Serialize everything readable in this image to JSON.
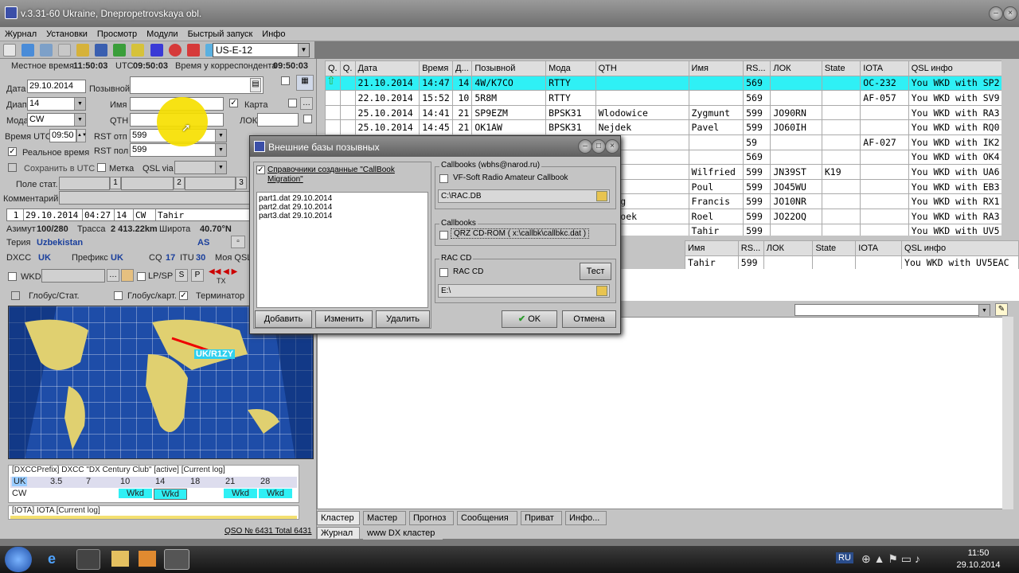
{
  "window": {
    "title": "v.3.31-60 Ukraine, Dnepropetrovskaya obl."
  },
  "menu": [
    "Журнал",
    "Установки",
    "Просмотр",
    "Модули",
    "Быстрый запуск",
    "Инфо"
  ],
  "toolbar": {
    "mode_select": "US-E-12"
  },
  "timebar": {
    "local_label": "Местное время",
    "local_value": "11:50:03",
    "utc_label": "UTC",
    "utc_value": "09:50:03",
    "corr_label": "Время у корреспондента",
    "corr_value": "09:50:03"
  },
  "form": {
    "date_label": "Дата",
    "date_value": "29.10.2014",
    "call_label": "Позывной",
    "band_label": "Диап",
    "band_value": "14",
    "name_label": "Имя",
    "map_label": "Карта",
    "mode_label": "Мода",
    "mode_value": "CW",
    "qth_label": "QTH",
    "loc_label": "ЛОК",
    "utc_time_label": "Время UTC",
    "utc_time_value": "09:50",
    "rst_sent_label": "RST отп",
    "rst_sent_value": "599",
    "real_time_label": "Реальное время",
    "rst_rcvd_label": "RST пол",
    "rst_rcvd_value": "599",
    "save_utc_label": "Сохранить в UTC",
    "mark_label": "Метка",
    "qsl_via_label": "QSL via",
    "field_stat_label": "Поле стат.",
    "stat_btns": [
      "1",
      "2",
      "3"
    ],
    "comment_label": "Комментарий"
  },
  "lastqso": {
    "num": "1",
    "date": "29.10.2014",
    "time": "04:27",
    "band": "14",
    "mode": "CW",
    "name": "Tahir"
  },
  "info": {
    "azimuth_label": "Азимут",
    "azimuth_value": "100/280",
    "route_label": "Трасса",
    "route_value": "2 413.22km",
    "lat_label": "Широта",
    "lat_value": "40.70°N",
    "territory_label": "Терия",
    "territory_value": "Uzbekistan",
    "continent": "AS",
    "dxcc_label": "DXCC",
    "dxcc_value": "UK",
    "prefix_label": "Префикс",
    "prefix_value": "UK",
    "cq_label": "CQ",
    "cq_value": "17",
    "itu_label": "ITU",
    "itu_value": "30",
    "myqsl_label": "Моя QSL",
    "wkd_label": "WKD",
    "lpsp_label": "LP/SP",
    "s_btn": "S",
    "p_btn": "P",
    "tx_label": "TX",
    "globe_stat_label": "Глобус/Стат.",
    "globe_map_label": "Глобус/карт.",
    "terminator_label": "Терминатор"
  },
  "map": {
    "callsign_tag": "UK/R1ZY"
  },
  "dxcc_panel": {
    "title": "[DXCCPrefix] DXCC \"DX Century Club\" [active] [Current log]",
    "headers": [
      "UK",
      "3.5",
      "7",
      "10",
      "14",
      "18",
      "21",
      "28"
    ],
    "row_label": "CW",
    "row_values": [
      "",
      "",
      "Wkd",
      "Wkd",
      "",
      "Wkd",
      "Wkd"
    ]
  },
  "iota_panel": {
    "title": "[IOTA] IOTA [Current log]"
  },
  "status": {
    "qso_count": "QSO № 6431 Total 6431"
  },
  "log_table": {
    "headers": [
      "Q.",
      "Q.",
      "Дата",
      "Время",
      "Д...",
      "Позывной",
      "Мода",
      "QTH",
      "Имя",
      "RS...",
      "ЛОК",
      "State",
      "IOTA",
      "QSL инфо"
    ],
    "rows": [
      [
        "",
        "",
        "21.10.2014",
        "14:47",
        "14",
        "4W/K7CO",
        "RTTY",
        "",
        "",
        "569",
        "",
        "",
        "OC-232",
        "You WKD with SP2"
      ],
      [
        "",
        "",
        "22.10.2014",
        "15:52",
        "10",
        "5R8M",
        "RTTY",
        "",
        "",
        "569",
        "",
        "",
        "AF-057",
        "You WKD with SV9"
      ],
      [
        "",
        "",
        "25.10.2014",
        "14:41",
        "21",
        "SP9EZM",
        "BPSK31",
        "Wlodowice",
        "Zygmunt",
        "599",
        "JO90RN",
        "",
        "",
        "You WKD with RA3"
      ],
      [
        "",
        "",
        "25.10.2014",
        "14:45",
        "21",
        "OK1AW",
        "BPSK31",
        "Nejdek",
        "Pavel",
        "599",
        "JO60IH",
        "",
        "",
        "You WKD with RQ0"
      ],
      [
        "",
        "",
        "",
        "",
        "",
        "",
        "",
        "",
        "",
        "59",
        "",
        "",
        "AF-027",
        "You WKD with IK2"
      ],
      [
        "",
        "",
        "",
        "",
        "",
        "",
        "",
        "",
        "",
        "569",
        "",
        "",
        "",
        "You WKD with OK4"
      ],
      [
        "",
        "",
        "",
        "",
        "",
        "",
        "",
        "heim",
        "Wilfried",
        "599",
        "JN39ST",
        "K19",
        "",
        "You WKD with UA6"
      ],
      [
        "",
        "",
        "",
        "",
        "",
        "",
        "",
        "ens",
        "Poul",
        "599",
        "JO45WU",
        "",
        "",
        "You WKD with EB3"
      ],
      [
        "",
        "",
        "",
        "",
        "",
        "",
        "",
        "coing",
        "Francis",
        "599",
        "JO10NR",
        "",
        "",
        "You WKD with RX1"
      ],
      [
        "",
        "",
        "",
        "",
        "",
        "",
        "",
        "cebroek",
        "Roel",
        "599",
        "JO22OQ",
        "",
        "",
        "You WKD with RA3"
      ],
      [
        "",
        "",
        "",
        "",
        "",
        "",
        "",
        "",
        "Tahir",
        "599",
        "",
        "",
        "",
        "You WKD with UV5"
      ]
    ]
  },
  "lower_table": {
    "headers": [
      "Имя",
      "RS...",
      "ЛОК",
      "State",
      "IOTA",
      "QSL инфо"
    ],
    "row": [
      "Tahir",
      "599",
      "",
      "",
      "",
      "You WKD with UV5EAC"
    ]
  },
  "tabs": [
    "Кластер",
    "Мастер",
    "Прогноз",
    "Сообщения",
    "Приват",
    "Инфо..."
  ],
  "tabs2": [
    "Журнал",
    "www DX кластер"
  ],
  "dialog": {
    "title": "Внешние базы позывных",
    "callbook_check": "Справочники созданные \"CallBook Migration\"",
    "files": [
      "part1.dat 29.10.2014",
      "part2.dat 29.10.2014",
      "part3.dat 29.10.2014"
    ],
    "add_btn": "Добавить",
    "edit_btn": "Изменить",
    "delete_btn": "Удалить",
    "grp1_title": "Callbooks (wbhs@narod.ru)",
    "vf_soft_label": "VF-Soft Radio Amateur Callbook",
    "vf_soft_path": "C:\\RAC.DB",
    "grp2_title": "Callbooks",
    "qrz_label": "QRZ CD-ROM  ( x:\\callbk\\callbkc.dat )",
    "grp3_title": "RAC CD",
    "rac_cd_label": "RAC CD",
    "test_btn": "Тест",
    "rac_cd_path": "E:\\",
    "ok_btn": "OK",
    "cancel_btn": "Отмена"
  },
  "taskbar": {
    "lang": "RU",
    "time": "11:50",
    "date": "29.10.2014"
  }
}
